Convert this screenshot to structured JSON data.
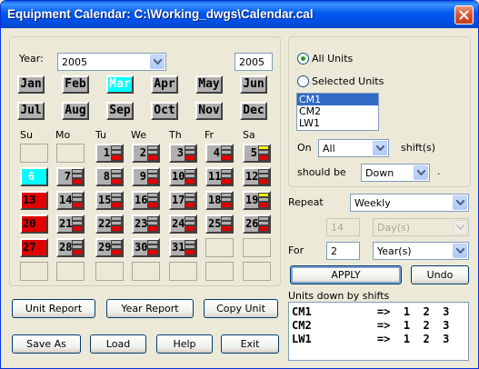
{
  "window": {
    "title": "Equipment Calendar: C:\\Working_dwgs\\Calendar.cal"
  },
  "calendar": {
    "year_label": "Year:",
    "year_combo_value": "2005",
    "year_text_value": "2005",
    "months": [
      "Jan",
      "Feb",
      "Mar",
      "Apr",
      "May",
      "Jun",
      "Jul",
      "Aug",
      "Sep",
      "Oct",
      "Nov",
      "Dec"
    ],
    "selected_month": "Mar",
    "weekdays": [
      "Su",
      "Mo",
      "Tu",
      "We",
      "Th",
      "Fr",
      "Sa"
    ],
    "days": [
      {
        "day": "1",
        "shifts": [
          "gray",
          "gray",
          "red"
        ]
      },
      {
        "day": "2",
        "shifts": [
          "gray",
          "gray",
          "red"
        ]
      },
      {
        "day": "3",
        "shifts": [
          "gray",
          "gray",
          "red"
        ]
      },
      {
        "day": "4",
        "shifts": [
          "gray",
          "gray",
          "red"
        ]
      },
      {
        "day": "5",
        "shifts": [
          "yellow",
          "gray",
          "red"
        ]
      },
      {
        "day": "6",
        "shifts": [],
        "today": true
      },
      {
        "day": "7",
        "shifts": [
          "gray",
          "gray",
          "red"
        ]
      },
      {
        "day": "8",
        "shifts": [
          "gray",
          "gray",
          "red"
        ]
      },
      {
        "day": "9",
        "shifts": [
          "gray",
          "gray",
          "red"
        ]
      },
      {
        "day": "10",
        "shifts": [
          "gray",
          "gray",
          "red"
        ]
      },
      {
        "day": "11",
        "shifts": [
          "gray",
          "gray",
          "red"
        ]
      },
      {
        "day": "12",
        "shifts": [
          "gray",
          "gray",
          "red"
        ]
      },
      {
        "day": "13",
        "shifts": [],
        "all_down": true
      },
      {
        "day": "14",
        "shifts": [
          "gray",
          "gray",
          "red"
        ]
      },
      {
        "day": "15",
        "shifts": [
          "gray",
          "gray",
          "red"
        ]
      },
      {
        "day": "16",
        "shifts": [
          "gray",
          "gray",
          "red"
        ]
      },
      {
        "day": "17",
        "shifts": [
          "gray",
          "gray",
          "red"
        ]
      },
      {
        "day": "18",
        "shifts": [
          "gray",
          "gray",
          "red"
        ]
      },
      {
        "day": "19",
        "shifts": [
          "yellow",
          "gray",
          "red"
        ]
      },
      {
        "day": "20",
        "shifts": [],
        "all_down": true
      },
      {
        "day": "21",
        "shifts": [
          "gray",
          "gray",
          "red"
        ]
      },
      {
        "day": "22",
        "shifts": [
          "gray",
          "gray",
          "red"
        ]
      },
      {
        "day": "23",
        "shifts": [
          "gray",
          "gray",
          "red"
        ]
      },
      {
        "day": "24",
        "shifts": [
          "gray",
          "gray",
          "red"
        ]
      },
      {
        "day": "25",
        "shifts": [
          "gray",
          "gray",
          "red"
        ]
      },
      {
        "day": "26",
        "shifts": [
          "gray",
          "gray",
          "red"
        ]
      },
      {
        "day": "27",
        "shifts": [],
        "all_down": true
      },
      {
        "day": "28",
        "shifts": [
          "gray",
          "gray",
          "red"
        ]
      },
      {
        "day": "29",
        "shifts": [
          "gray",
          "gray",
          "red"
        ]
      },
      {
        "day": "30",
        "shifts": [
          "gray",
          "gray",
          "red"
        ]
      },
      {
        "day": "31",
        "shifts": [
          "gray",
          "gray",
          "red"
        ]
      }
    ],
    "first_weekday": 2,
    "shift_colors": {
      "gray": "#B0B0B0",
      "red": "#E00000",
      "yellow": "#FFFF00",
      "cyan": "#00FFFF"
    }
  },
  "units": {
    "all_units_label": "All Units",
    "selected_units_label": "Selected Units",
    "all_units_checked": true,
    "list": [
      "CM1",
      "CM2",
      "LW1"
    ],
    "selected": "CM1",
    "on_label": "On",
    "on_value": "All",
    "shifts_label": "shift(s)",
    "should_be_label": "should be",
    "should_be_value": "Down",
    "period_label": "."
  },
  "repeat": {
    "repeat_label": "Repeat",
    "repeat_value": "Weekly",
    "interval_value": "14",
    "interval_unit": "Day(s)",
    "for_label": "For",
    "for_value": "2",
    "for_unit": "Year(s)",
    "apply_label": "APPLY",
    "undo_label": "Undo"
  },
  "status": {
    "label": "Units down by shifts",
    "rows": [
      "CM1          =>  1  2  3",
      "CM2          =>  1  2  3",
      "LW1          =>  1  2  3"
    ]
  },
  "buttons": {
    "unit_report": "Unit Report",
    "year_report": "Year Report",
    "copy_unit": "Copy Unit",
    "save_as": "Save As",
    "load": "Load",
    "help": "Help",
    "exit": "Exit"
  }
}
